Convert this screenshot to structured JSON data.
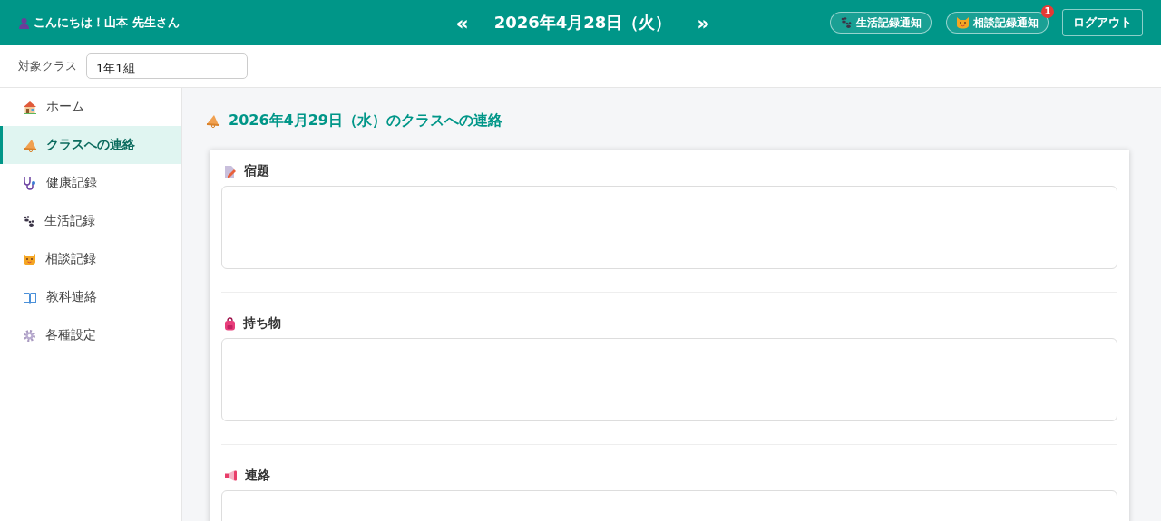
{
  "header": {
    "greeting": "こんにちは！山本 先生さん",
    "prev": "«",
    "date": "2026年4月28日（火）",
    "next": "»",
    "buttons": [
      {
        "kind": "life",
        "label": "生活記録通知"
      },
      {
        "kind": "consult",
        "label": "相談記録通知",
        "badge": "1"
      }
    ],
    "logout": "ログアウト"
  },
  "class_bar": {
    "label": "対象クラス",
    "value": "1年1組"
  },
  "sidebar": {
    "items": [
      {
        "label": "ホーム",
        "selected": false
      },
      {
        "label": "クラスへの連絡",
        "selected": true
      },
      {
        "label": "健康記録",
        "selected": false
      },
      {
        "label": "生活記録",
        "selected": false
      },
      {
        "label": "相談記録",
        "selected": false
      },
      {
        "label": "教科連絡",
        "selected": false
      },
      {
        "label": "各種設定",
        "selected": false
      }
    ]
  },
  "main": {
    "title": "2026年4月29日（水）のクラスへの連絡",
    "sections": [
      {
        "label": "宿題"
      },
      {
        "label": "持ち物"
      },
      {
        "label": "連絡"
      }
    ]
  }
}
